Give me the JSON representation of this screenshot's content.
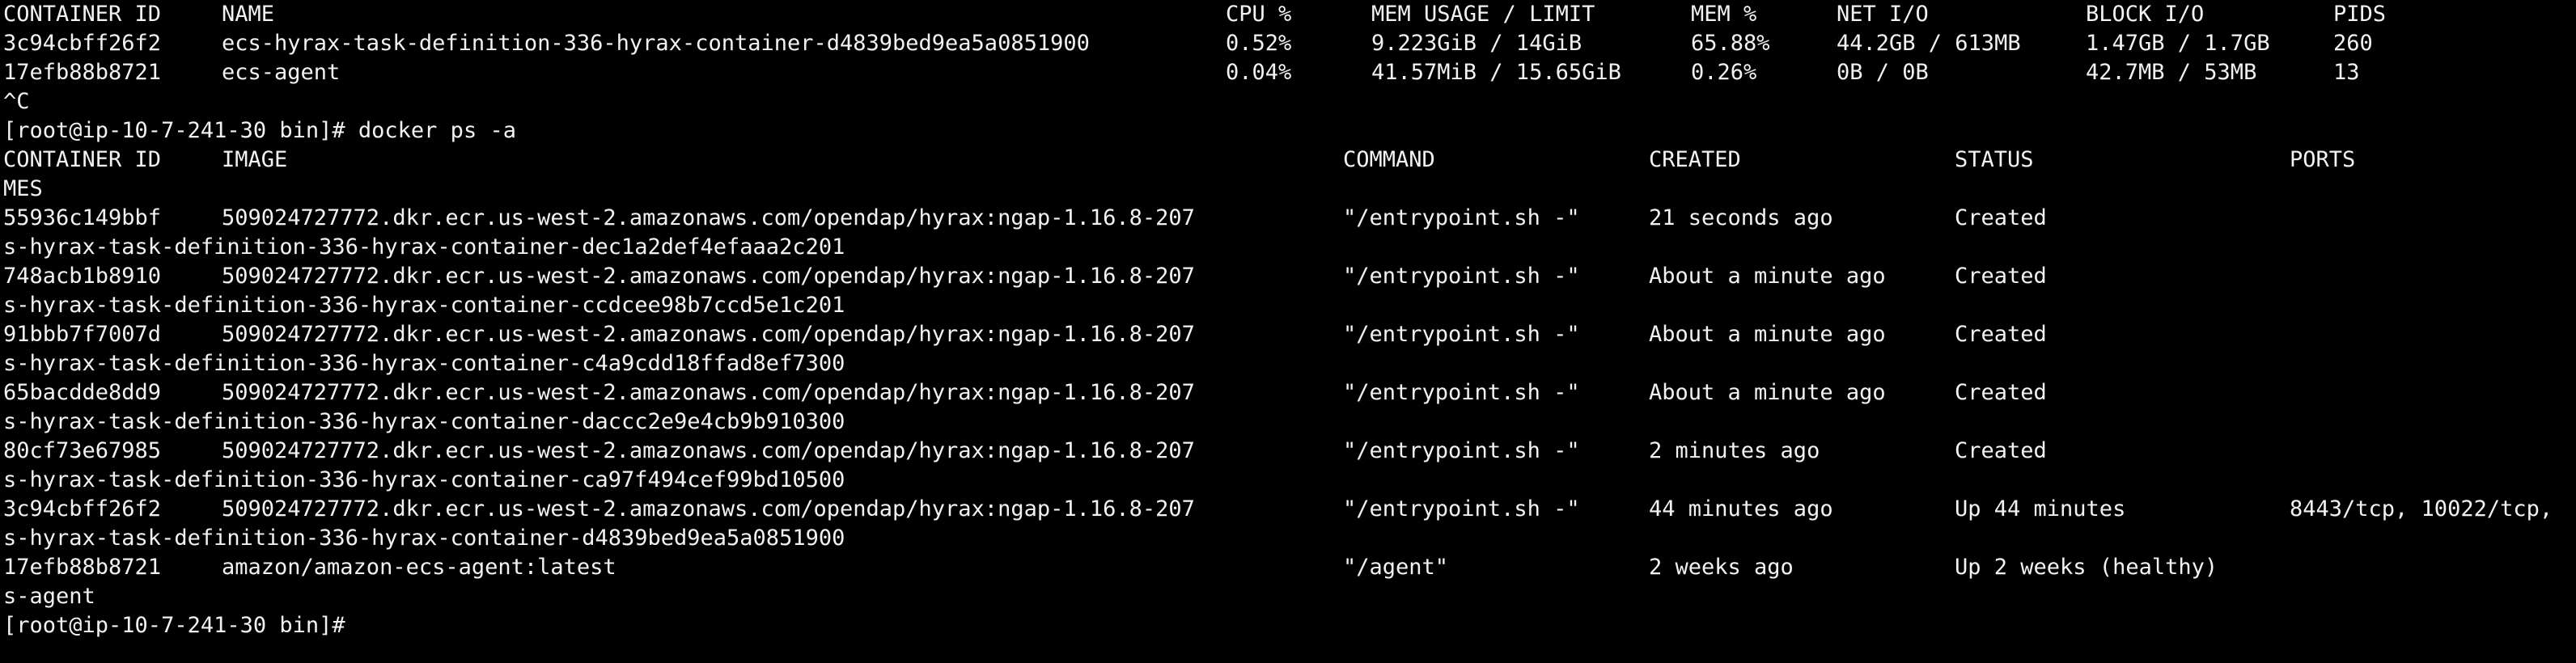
{
  "stats": {
    "headers": {
      "container_id": "CONTAINER ID",
      "name": "NAME",
      "cpu": "CPU %",
      "mem_usage": "MEM USAGE / LIMIT",
      "mem_pct": "MEM %",
      "net_io": "NET I/O",
      "block_io": "BLOCK I/O",
      "pids": "PIDS"
    },
    "rows": [
      {
        "container_id": "3c94cbff26f2",
        "name": "ecs-hyrax-task-definition-336-hyrax-container-d4839bed9ea5a0851900",
        "cpu": "0.52%",
        "mem_usage": "9.223GiB / 14GiB",
        "mem_pct": "65.88%",
        "net_io": "44.2GB / 613MB",
        "block_io": "1.47GB / 1.7GB",
        "pids": "260"
      },
      {
        "container_id": "17efb88b8721",
        "name": "ecs-agent",
        "cpu": "0.04%",
        "mem_usage": "41.57MiB / 15.65GiB",
        "mem_pct": "0.26%",
        "net_io": "0B / 0B",
        "block_io": "42.7MB / 53MB",
        "pids": "13"
      }
    ]
  },
  "interrupt": "^C",
  "prompt_command": "[root@ip-10-7-241-30 bin]# docker ps -a",
  "ps": {
    "headers": {
      "container_id": "CONTAINER ID",
      "image": "IMAGE",
      "command": "COMMAND",
      "created": "CREATED",
      "status": "STATUS",
      "ports": "PORTS"
    },
    "names_wrap": "MES",
    "rows": [
      {
        "container_id": "55936c149bbf",
        "image": "509024727772.dkr.ecr.us-west-2.amazonaws.com/opendap/hyrax:ngap-1.16.8-207",
        "command": "\"/entrypoint.sh -\"",
        "created": "21 seconds ago",
        "status": "Created",
        "ports": "",
        "name_wrap": "s-hyrax-task-definition-336-hyrax-container-dec1a2def4efaaa2c201"
      },
      {
        "container_id": "748acb1b8910",
        "image": "509024727772.dkr.ecr.us-west-2.amazonaws.com/opendap/hyrax:ngap-1.16.8-207",
        "command": "\"/entrypoint.sh -\"",
        "created": "About a minute ago",
        "status": "Created",
        "ports": "",
        "name_wrap": "s-hyrax-task-definition-336-hyrax-container-ccdcee98b7ccd5e1c201"
      },
      {
        "container_id": "91bbb7f7007d",
        "image": "509024727772.dkr.ecr.us-west-2.amazonaws.com/opendap/hyrax:ngap-1.16.8-207",
        "command": "\"/entrypoint.sh -\"",
        "created": "About a minute ago",
        "status": "Created",
        "ports": "",
        "name_wrap": "s-hyrax-task-definition-336-hyrax-container-c4a9cdd18ffad8ef7300"
      },
      {
        "container_id": "65bacdde8dd9",
        "image": "509024727772.dkr.ecr.us-west-2.amazonaws.com/opendap/hyrax:ngap-1.16.8-207",
        "command": "\"/entrypoint.sh -\"",
        "created": "About a minute ago",
        "status": "Created",
        "ports": "",
        "name_wrap": "s-hyrax-task-definition-336-hyrax-container-daccc2e9e4cb9b910300"
      },
      {
        "container_id": "80cf73e67985",
        "image": "509024727772.dkr.ecr.us-west-2.amazonaws.com/opendap/hyrax:ngap-1.16.8-207",
        "command": "\"/entrypoint.sh -\"",
        "created": "2 minutes ago",
        "status": "Created",
        "ports": "",
        "name_wrap": "s-hyrax-task-definition-336-hyrax-container-ca97f494cef99bd10500"
      },
      {
        "container_id": "3c94cbff26f2",
        "image": "509024727772.dkr.ecr.us-west-2.amazonaws.com/opendap/hyrax:ngap-1.16.8-207",
        "command": "\"/entrypoint.sh -\"",
        "created": "44 minutes ago",
        "status": "Up 44 minutes",
        "ports": "8443/tcp, 10022/tcp,",
        "name_wrap": "s-hyrax-task-definition-336-hyrax-container-d4839bed9ea5a0851900"
      },
      {
        "container_id": "17efb88b8721",
        "image": "amazon/amazon-ecs-agent:latest",
        "command": "\"/agent\"",
        "created": "2 weeks ago",
        "status": "Up 2 weeks (healthy)",
        "ports": "",
        "name_wrap": "s-agent"
      }
    ]
  },
  "final_prompt": "[root@ip-10-7-241-30 bin]#"
}
